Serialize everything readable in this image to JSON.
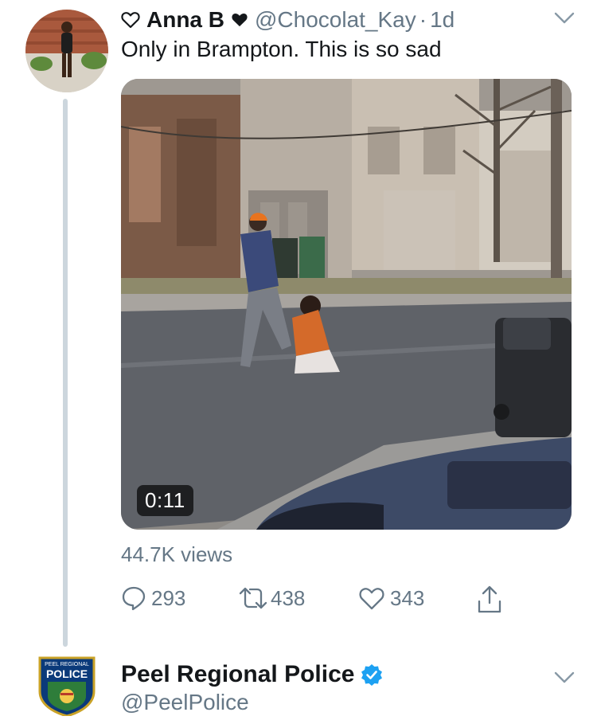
{
  "tweet": {
    "display_name": "Anna B",
    "handle": "@Chocolat_Kay",
    "separator": "·",
    "time_ago": "1d",
    "text": "Only in Brampton. This is so sad",
    "media": {
      "duration": "0:11"
    },
    "views": "44.7K views",
    "actions": {
      "replies": "293",
      "retweets": "438",
      "likes": "343"
    }
  },
  "reply_account": {
    "display_name": "Peel Regional Police",
    "handle": "@PeelPolice",
    "verified": true,
    "badge_top_text": "PEEL REGIONAL",
    "badge_text": "POLICE"
  },
  "icons": {
    "name_prefix": "heart-outline-icon",
    "name_suffix": "black-heart-icon",
    "menu": "chevron-down-icon",
    "reply": "reply-bubble-icon",
    "retweet": "retweet-icon",
    "like": "heart-outline-icon",
    "share": "share-icon",
    "verified": "verified-badge-icon"
  },
  "colors": {
    "secondary_text": "#657786",
    "verified_blue": "#1da1f2",
    "thread_line": "#ccd6dd"
  }
}
